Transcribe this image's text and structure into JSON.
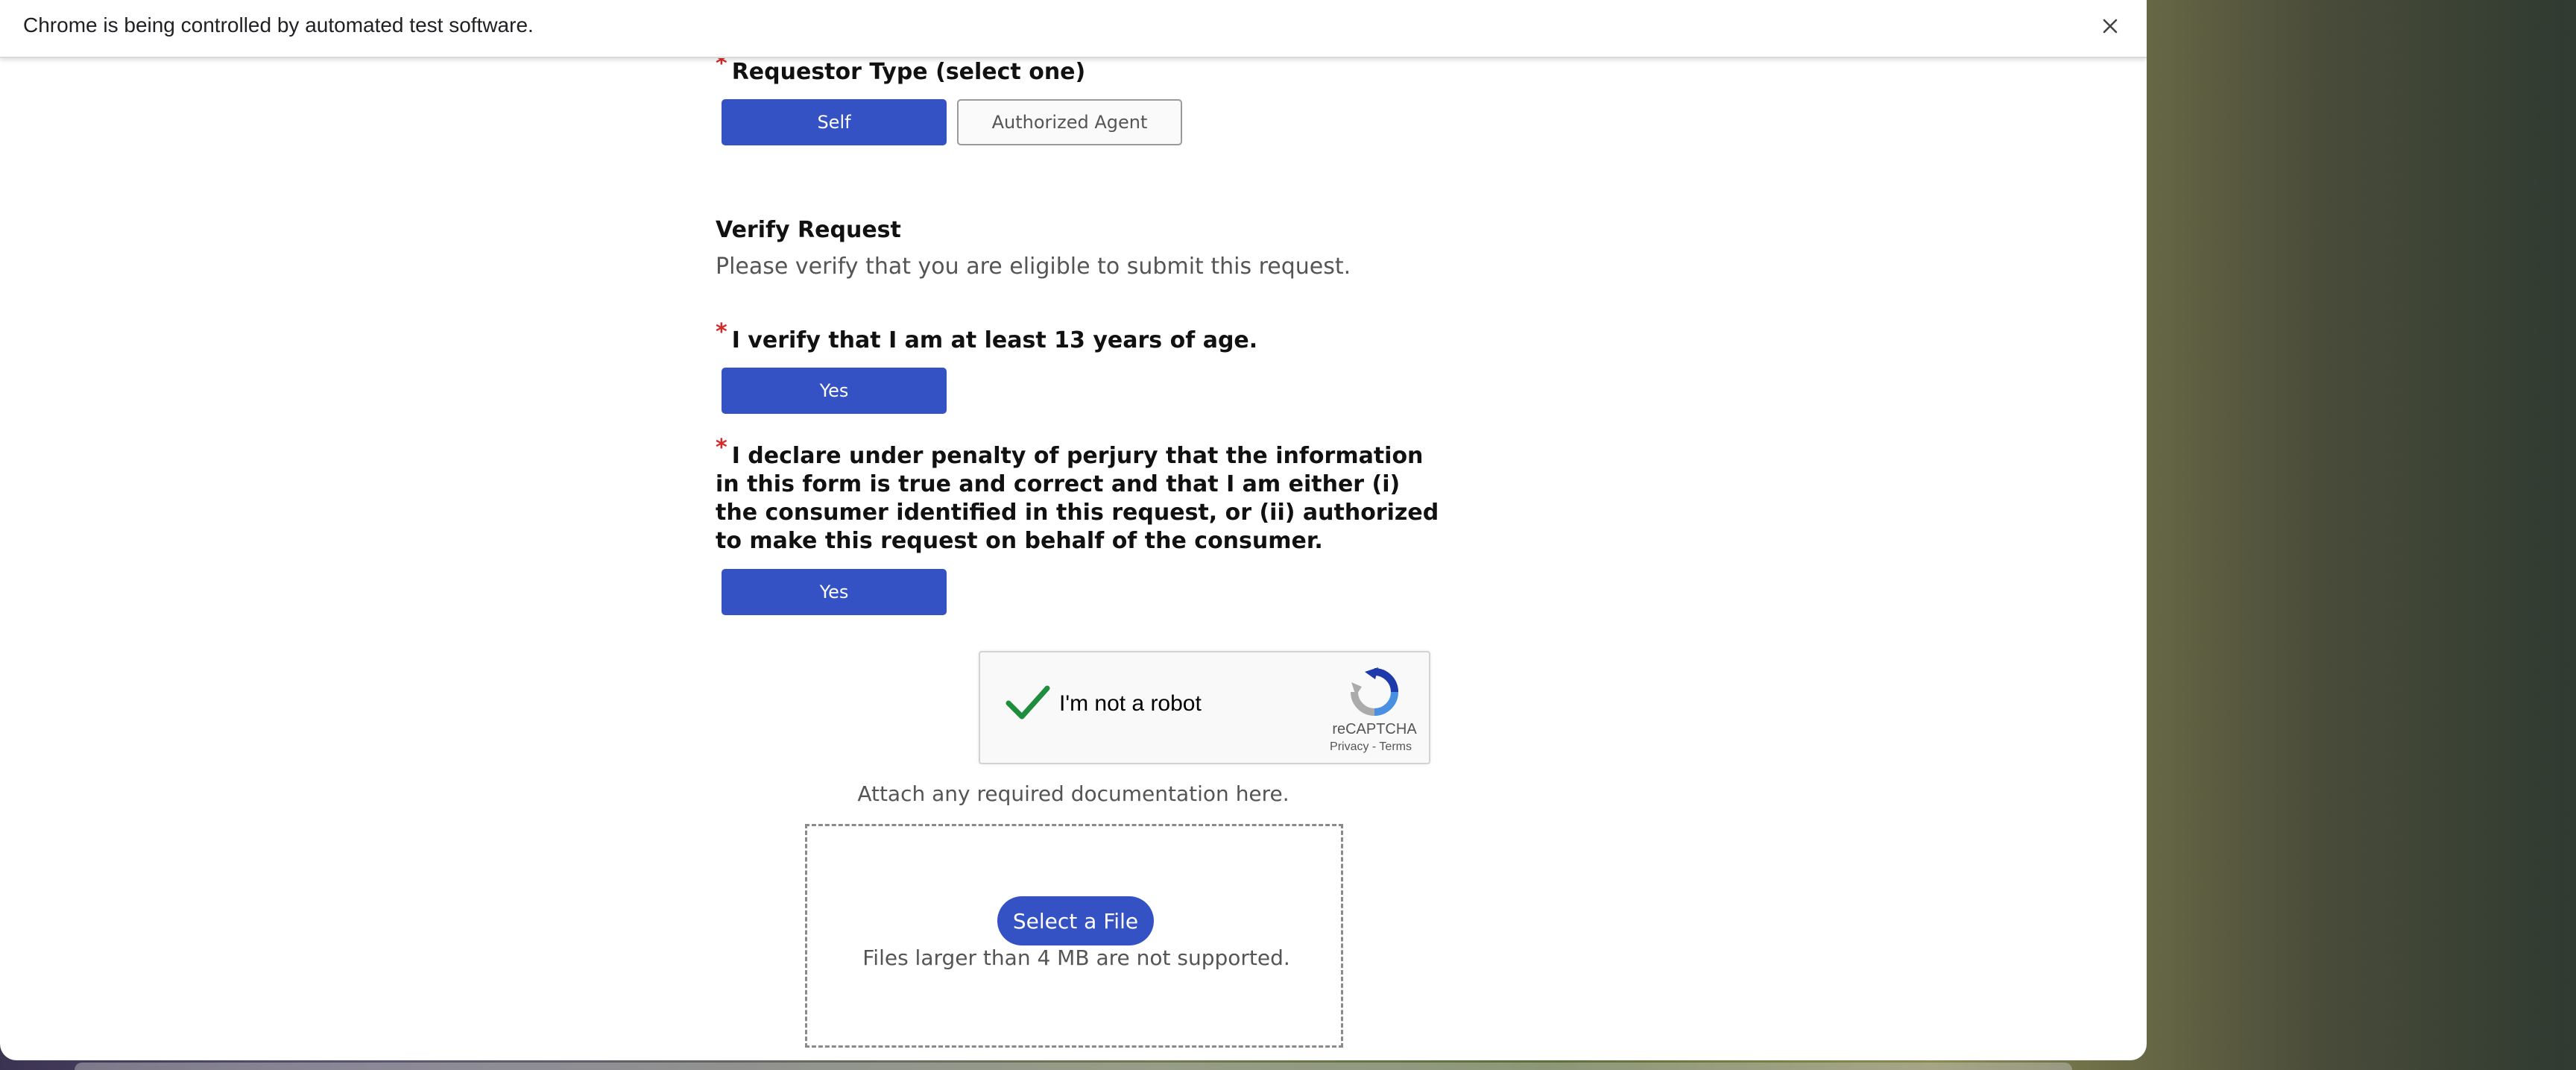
{
  "infobar": {
    "message": "Chrome is being controlled by automated test software.",
    "close_icon": "close-icon"
  },
  "requestor": {
    "label": "Requestor Type (select one)",
    "required_mark": "*",
    "options": [
      {
        "label": "Self",
        "selected": true
      },
      {
        "label": "Authorized Agent",
        "selected": false
      }
    ]
  },
  "verify": {
    "title": "Verify Request",
    "description": "Please verify that you are eligible to submit this request.",
    "age_question": "I verify that I am at least 13 years of age.",
    "age_answer": "Yes",
    "perjury_question": "I declare under penalty of perjury that the information in this form is true and correct and that I am either (i) the consumer identified in this request, or (ii) authorized to make this request on behalf of the consumer.",
    "perjury_answer": "Yes"
  },
  "captcha": {
    "label": "I'm not a robot",
    "brand": "reCAPTCHA",
    "links": "Privacy - Terms",
    "checked": true
  },
  "attachments": {
    "label": "Attach any required documentation here.",
    "button": "Select a File",
    "note": "Files larger than 4 MB are not supported."
  },
  "colors": {
    "accent": "#3552c4",
    "required": "#d42a2a",
    "check": "#1e8e3e"
  }
}
